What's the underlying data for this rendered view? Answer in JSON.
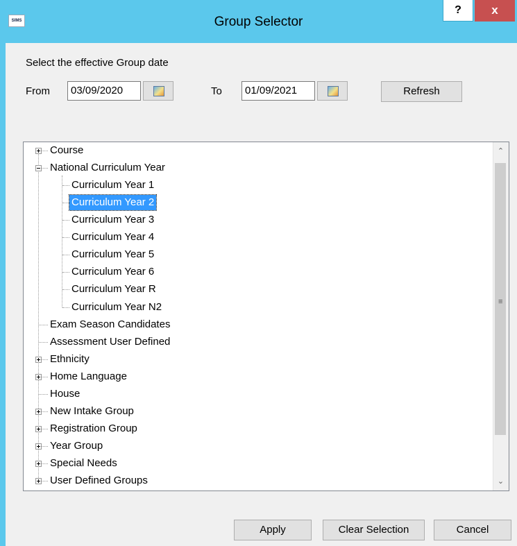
{
  "window": {
    "title": "Group Selector",
    "app_icon_text": "SIMS",
    "help_label": "?",
    "close_label": "x"
  },
  "date_section": {
    "prompt": "Select the effective Group date",
    "from_label": "From",
    "from_value": "03/09/2020",
    "to_label": "To",
    "to_value": "01/09/2021",
    "refresh_label": "Refresh"
  },
  "tree": {
    "nodes": [
      {
        "label": "Course",
        "expander": "plus"
      },
      {
        "label": "National Curriculum Year",
        "expander": "minus",
        "expanded": true,
        "children": [
          {
            "label": "Curriculum Year  1"
          },
          {
            "label": "Curriculum Year  2",
            "selected": true
          },
          {
            "label": "Curriculum Year  3"
          },
          {
            "label": "Curriculum Year  4"
          },
          {
            "label": "Curriculum Year  5"
          },
          {
            "label": "Curriculum Year  6"
          },
          {
            "label": "Curriculum Year  R"
          },
          {
            "label": "Curriculum Year N2"
          }
        ]
      },
      {
        "label": "Exam Season Candidates",
        "expander": "none"
      },
      {
        "label": "Assessment User Defined",
        "expander": "none"
      },
      {
        "label": "Ethnicity",
        "expander": "plus"
      },
      {
        "label": "Home Language",
        "expander": "plus"
      },
      {
        "label": "House",
        "expander": "none"
      },
      {
        "label": "New Intake Group",
        "expander": "plus"
      },
      {
        "label": "Registration Group",
        "expander": "plus"
      },
      {
        "label": "Year Group",
        "expander": "plus"
      },
      {
        "label": "Special Needs",
        "expander": "plus"
      },
      {
        "label": "User Defined Groups",
        "expander": "plus"
      }
    ],
    "scrollbar": {
      "up_icon": "chevron-up-icon",
      "down_icon": "chevron-down-icon",
      "grip_icon": "grip-icon"
    }
  },
  "buttons": {
    "apply": "Apply",
    "clear": "Clear Selection",
    "cancel": "Cancel"
  },
  "colors": {
    "titlebar": "#5BC8EC",
    "close": "#C75050",
    "selection": "#3399FF"
  }
}
